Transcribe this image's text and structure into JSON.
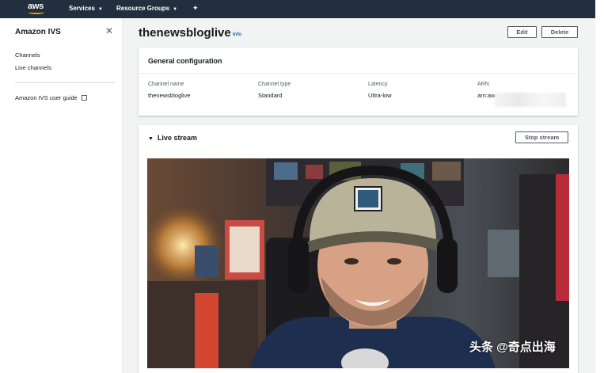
{
  "nav": {
    "logo_text": "aws",
    "services_label": "Services",
    "resource_groups_label": "Resource Groups"
  },
  "sidebar": {
    "title": "Amazon IVS",
    "items": [
      {
        "label": "Channels"
      },
      {
        "label": "Live channels"
      }
    ],
    "guide_label": "Amazon IVS user guide"
  },
  "page": {
    "title": "thenewsbloglive",
    "info_label": "Info",
    "edit_label": "Edit",
    "delete_label": "Delete"
  },
  "general_config": {
    "title": "General configuration",
    "channel_name_label": "Channel name",
    "channel_name_value": "thenewsbloglive",
    "channel_type_label": "Channel type",
    "channel_type_value": "Standard",
    "latency_label": "Latency",
    "latency_value": "Ultra-low",
    "arn_label": "ARN",
    "arn_value": "arn:aws:"
  },
  "live_stream": {
    "title": "Live stream",
    "stop_label": "Stop stream"
  },
  "watermark": {
    "text": "头条 @奇点出海"
  },
  "colors": {
    "nav_bg": "#232f3e",
    "aws_orange": "#ff9900",
    "link_blue": "#0073bb"
  }
}
